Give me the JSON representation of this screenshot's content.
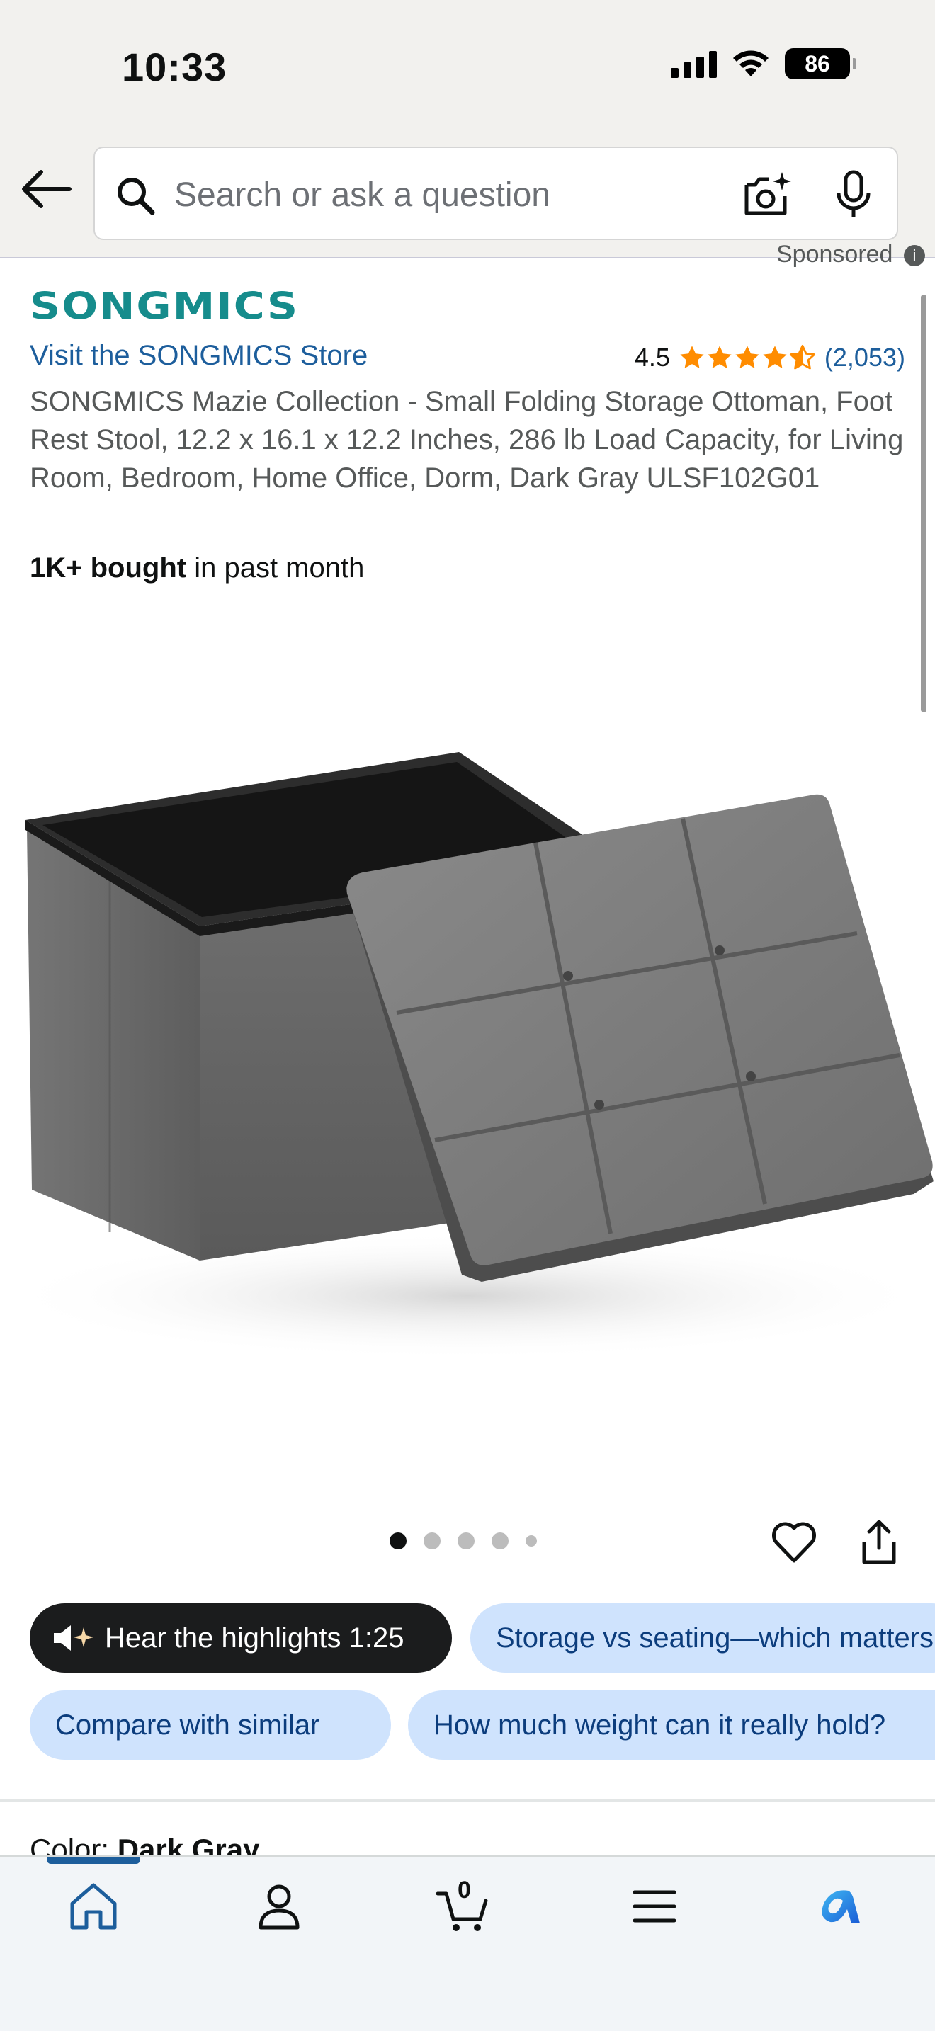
{
  "status_bar": {
    "time": "10:33",
    "battery": "86"
  },
  "search": {
    "placeholder": "Search or ask a question"
  },
  "sponsored": "Sponsored",
  "product": {
    "brand": "SONGMICS",
    "store_link": "Visit the SONGMICS Store",
    "rating": "4.5",
    "rating_count": "(2,053)",
    "title": "SONGMICS Mazie Collection - Small Folding Storage Ottoman, Foot Rest Stool, 12.2 x 16.1 x 12.2 Inches, 286 lb Load Capacity, for Living Room, Bedroom, Home Office, Dorm, Dark Gray ULSF102G01",
    "bought_bold": "1K+ bought",
    "bought_rest": " in past month",
    "image_count": 5,
    "current_image": 1
  },
  "chips": {
    "hear": "Hear the highlights 1:25",
    "q1": "Storage vs seating—which matters",
    "q2": "Compare with similar",
    "q3": "How much weight can it really hold?"
  },
  "color": {
    "label": "Color: ",
    "value": "Dark Gray"
  },
  "nav": {
    "cart_count": "0"
  },
  "colors": {
    "brand_teal": "#168c8c",
    "link_blue": "#1d5e9c",
    "star_orange": "#ff8c00",
    "chip_blue": "#cfe3fd"
  },
  "icons": [
    "back-arrow-icon",
    "search-icon",
    "camera-icon",
    "mic-icon",
    "heart-icon",
    "share-icon",
    "speaker-sparkle-icon",
    "home-icon",
    "account-icon",
    "cart-icon",
    "menu-icon",
    "rufus-icon"
  ]
}
